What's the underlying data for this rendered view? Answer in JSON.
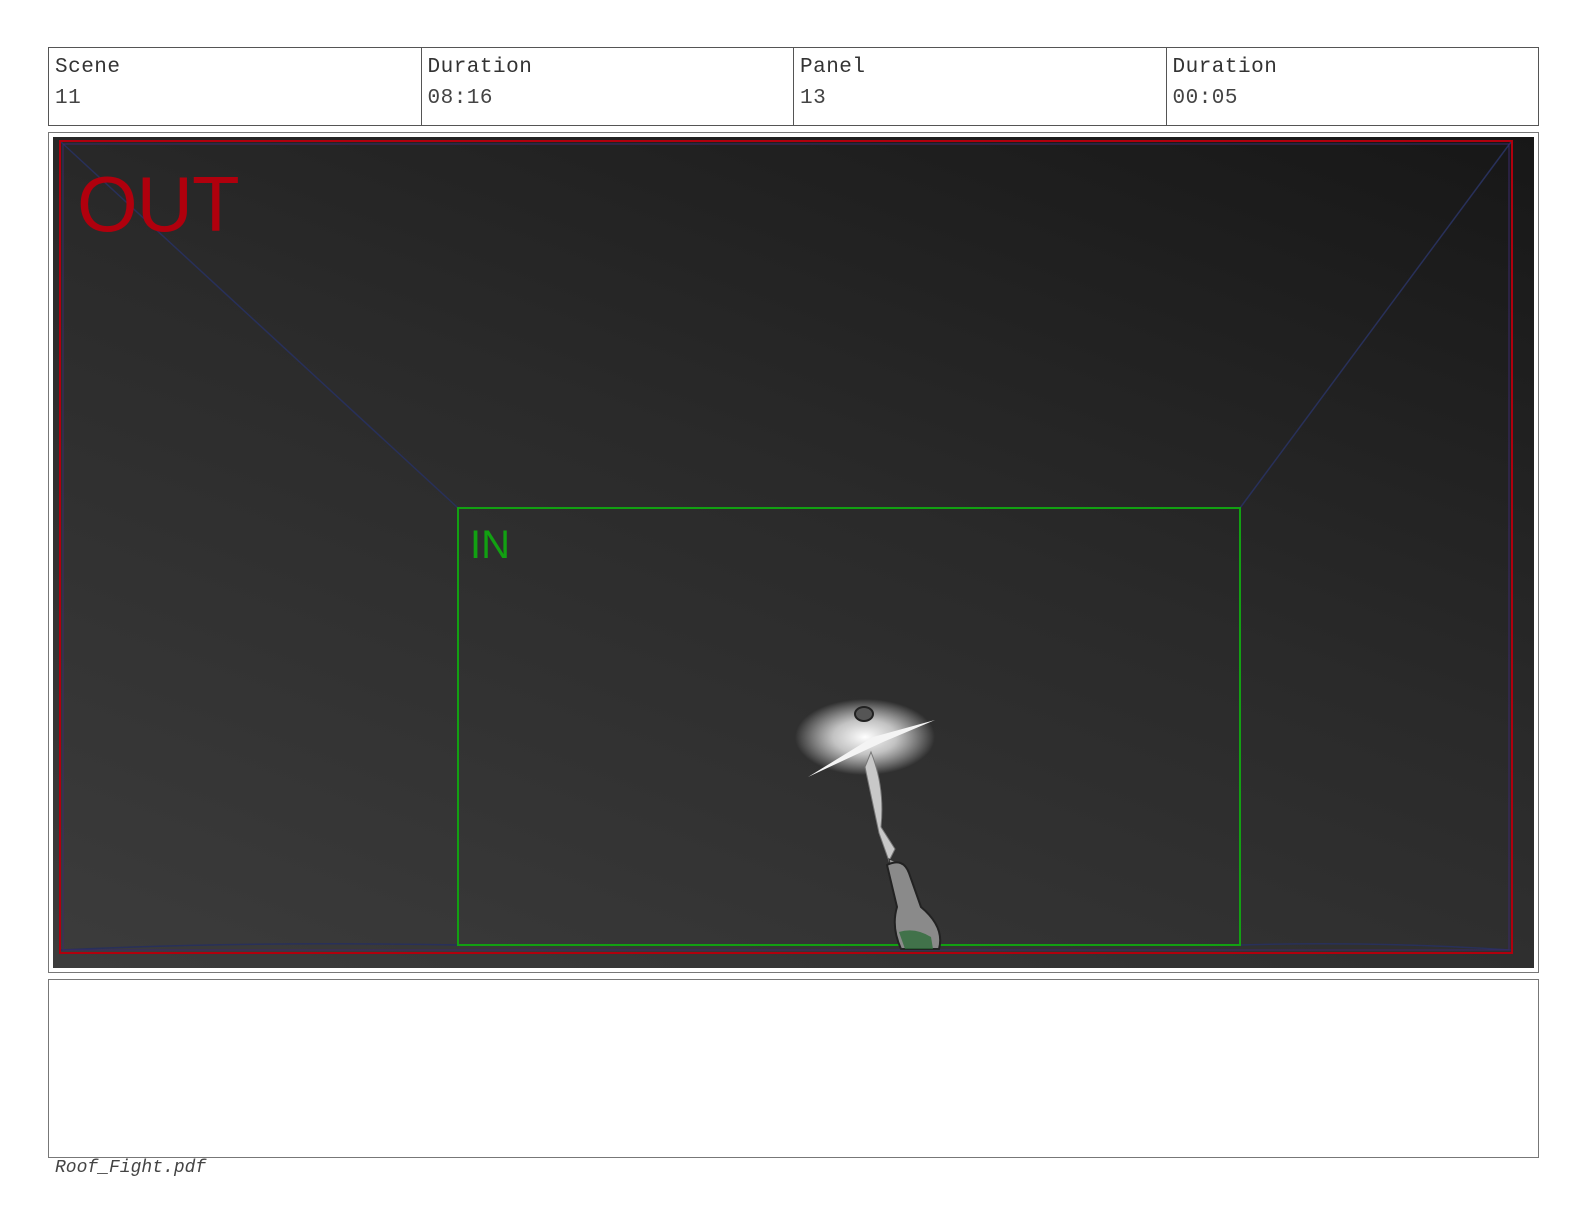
{
  "header": {
    "scene_label": "Scene",
    "scene_value": "11",
    "duration_label": "Duration",
    "duration_value": "08:16",
    "panel_label": "Panel",
    "panel_value": "13",
    "panel_duration_label": "Duration",
    "panel_duration_value": "00:05"
  },
  "frame": {
    "out_label": "OUT",
    "in_label": "IN",
    "colors": {
      "out": "#b0000d",
      "in": "#12a012",
      "perspective": "#28305a",
      "background": "#2a2a2a"
    }
  },
  "notes": {
    "text": ""
  },
  "footer": {
    "filename": "Roof_Fight.pdf"
  }
}
